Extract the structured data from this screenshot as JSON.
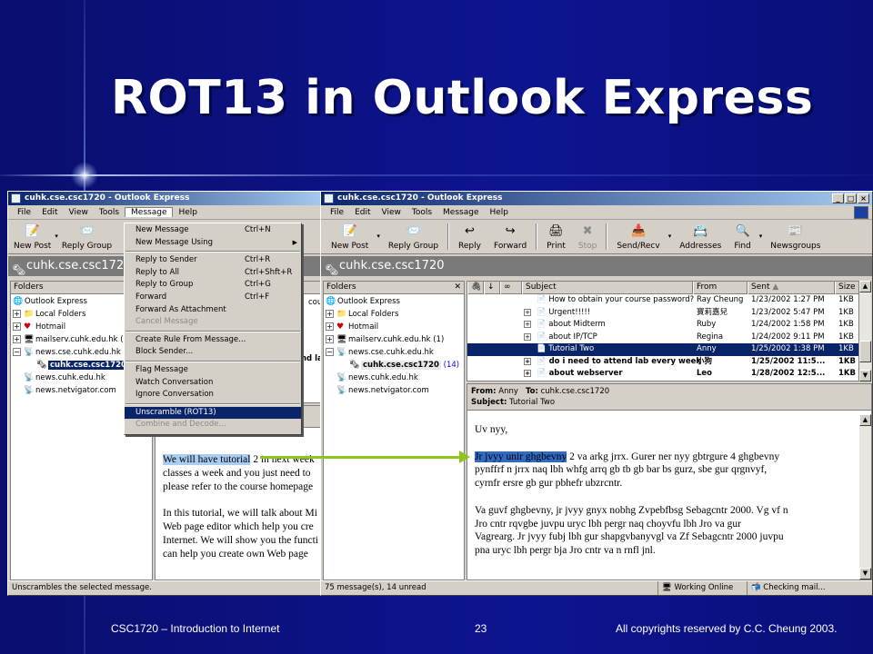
{
  "slide": {
    "title": "ROT13 in Outlook Express",
    "footer_left": "CSC1720 – Introduction to Internet",
    "footer_page": "23",
    "footer_right": "All copyrights reserved by C.C. Cheung 2003."
  },
  "left_window": {
    "title": "cuhk.cse.csc1720 - Outlook Express",
    "menu": [
      "File",
      "Edit",
      "View",
      "Tools",
      "Message",
      "Help"
    ],
    "active_menu": "Message",
    "toolbar": [
      "New Post",
      "Reply Group"
    ],
    "address": "cuhk.cse.csc1720",
    "folders_header": "Folders",
    "folders": [
      {
        "label": "Outlook Express",
        "icon": "outlook-icon"
      },
      {
        "label": "Local Folders",
        "icon": "folder-icon"
      },
      {
        "label": "Hotmail",
        "icon": "hotmail-icon"
      },
      {
        "label": "mailserv.cuhk.edu.hk (1",
        "icon": "server-icon"
      },
      {
        "label": "news.cse.cuhk.edu.hk",
        "icon": "news-icon"
      },
      {
        "label": "cuhk.cse.csc1720",
        "icon": "newsgroup-icon"
      },
      {
        "label": "news.cuhk.edu.hk",
        "icon": "news-icon"
      },
      {
        "label": "news.netvigator.com",
        "icon": "news-icon"
      }
    ],
    "status": "Unscrambles the selected message.",
    "message_menu": [
      {
        "label": "New Message",
        "shortcut": "Ctrl+N"
      },
      {
        "label": "New Message Using",
        "shortcut": "",
        "submenu": true
      },
      {
        "sep": true
      },
      {
        "label": "Reply to Sender",
        "shortcut": "Ctrl+R"
      },
      {
        "label": "Reply to All",
        "shortcut": "Ctrl+Shft+R"
      },
      {
        "label": "Reply to Group",
        "shortcut": "Ctrl+G"
      },
      {
        "label": "Forward",
        "shortcut": "Ctrl+F"
      },
      {
        "label": "Forward As Attachment",
        "shortcut": ""
      },
      {
        "label": "Cancel Message",
        "shortcut": "",
        "disabled": true
      },
      {
        "sep": true
      },
      {
        "label": "Create Rule From Message...",
        "shortcut": ""
      },
      {
        "label": "Block Sender...",
        "shortcut": ""
      },
      {
        "sep": true
      },
      {
        "label": "Flag Message",
        "shortcut": ""
      },
      {
        "label": "Watch Conversation",
        "shortcut": ""
      },
      {
        "label": "Ignore Conversation",
        "shortcut": ""
      },
      {
        "sep": true
      },
      {
        "label": "Unscramble (ROT13)",
        "shortcut": "",
        "highlighted": true
      },
      {
        "label": "Combine and Decode...",
        "shortcut": "",
        "disabled": true
      }
    ],
    "body_lines": [
      "We will have tutorial 2 in next week",
      "classes a week and you just need to",
      "please refer to the course homepage",
      "",
      "In this tutorial, we will talk about Mi",
      "Web page editor which help you cre",
      "Internet. We will show you the functi",
      "can help you create own Web page"
    ],
    "body_highlight": "We will have tutorial",
    "partial_right_texts": [
      "cours",
      "nd la"
    ]
  },
  "right_window": {
    "title": "cuhk.cse.csc1720 - Outlook Express",
    "menu": [
      "File",
      "Edit",
      "View",
      "Tools",
      "Message",
      "Help"
    ],
    "toolbar": [
      {
        "label": "New Post",
        "icon": "new-post-icon"
      },
      {
        "label": "Reply Group",
        "icon": "reply-group-icon"
      },
      {
        "label": "Reply",
        "icon": "reply-icon"
      },
      {
        "label": "Forward",
        "icon": "forward-icon"
      },
      {
        "label": "Print",
        "icon": "print-icon"
      },
      {
        "label": "Stop",
        "icon": "stop-icon",
        "disabled": true
      },
      {
        "label": "Send/Recv",
        "icon": "send-recv-icon"
      },
      {
        "label": "Addresses",
        "icon": "addresses-icon"
      },
      {
        "label": "Find",
        "icon": "find-icon"
      },
      {
        "label": "Newsgroups",
        "icon": "newsgroups-icon"
      }
    ],
    "address": "cuhk.cse.csc1720",
    "folders_header": "Folders",
    "folders": [
      {
        "label": "Outlook Express"
      },
      {
        "label": "Local Folders"
      },
      {
        "label": "Hotmail"
      },
      {
        "label": "mailserv.cuhk.edu.hk (1)"
      },
      {
        "label": "news.cse.cuhk.edu.hk"
      },
      {
        "label": "cuhk.cse.csc1720",
        "count": "(14)"
      },
      {
        "label": "news.cuhk.edu.hk"
      },
      {
        "label": "news.netvigator.com"
      }
    ],
    "columns": [
      "Subject",
      "From",
      "Sent",
      "Size"
    ],
    "messages": [
      {
        "subject": "How to obtain your course password?",
        "from": "Ray Cheung",
        "sent": "1/23/2002 1:27 PM",
        "size": "1KB"
      },
      {
        "subject": "Urgent!!!!!",
        "from": "寶莉嘉兒",
        "sent": "1/23/2002 5:47 PM",
        "size": "1KB"
      },
      {
        "subject": "about Midterm",
        "from": "Ruby",
        "sent": "1/24/2002 1:58 PM",
        "size": "1KB"
      },
      {
        "subject": "about IP/TCP",
        "from": "Regina",
        "sent": "1/24/2002 9:11 PM",
        "size": "1KB"
      },
      {
        "subject": "Tutorial Two",
        "from": "Anny",
        "sent": "1/25/2002 1:38 PM",
        "size": "1KB",
        "selected": true
      },
      {
        "subject": "do i need to attend lab every week?",
        "from": "小狗",
        "sent": "1/25/2002 11:5...",
        "size": "1KB",
        "unread": true
      },
      {
        "subject": "about webserver",
        "from": "Leo",
        "sent": "1/28/2002 12:5...",
        "size": "1KB",
        "unread": true
      }
    ],
    "preview": {
      "from_label": "From:",
      "from": "Anny",
      "to_label": "To:",
      "to": "cuhk.cse.csc1720",
      "subject_label": "Subject:",
      "subject": "Tutorial Two",
      "greeting": "Uv nyy,",
      "highlight": "Jr jvyy unir ghgbevny",
      "lines": [
        " 2 va arkg jrrx. Gurer ner nyy gbtrgure 4 ghgbevny",
        "pynffrf n jrrx naq lbh whfg arrq gb tb gb bar bs gurz, sbe gur qrgnvyf,",
        "cyrnfr ersre gb gur pbhefr ubzrcntr.",
        "",
        "Va guvf ghgbevny, jr jvyy gnyx nobhg Zvpebfbsg Sebagcntr 2000. Vg vf n",
        "Jro cntr rqvgbe juvpu uryc lbh pergr naq choyvfu lbh Jro va gur",
        "Vagrearg. Jr jvyy fubj lbh gur shapgvbanyvgl va Zf Sebagcntr 2000 juvpu",
        "pna uryc lbh pergr bja Jro cntr va n rnfl jnl."
      ]
    },
    "status": {
      "count": "75 message(s), 14 unread",
      "online": "Working Online",
      "checking": "Checking mail..."
    }
  },
  "colors": {
    "slide_bg": "#0a0f7a",
    "title_bar": "#0a246a",
    "selection": "#0a246a",
    "highlight_text": "#a8cdf0",
    "arrow": "#8bc520"
  }
}
